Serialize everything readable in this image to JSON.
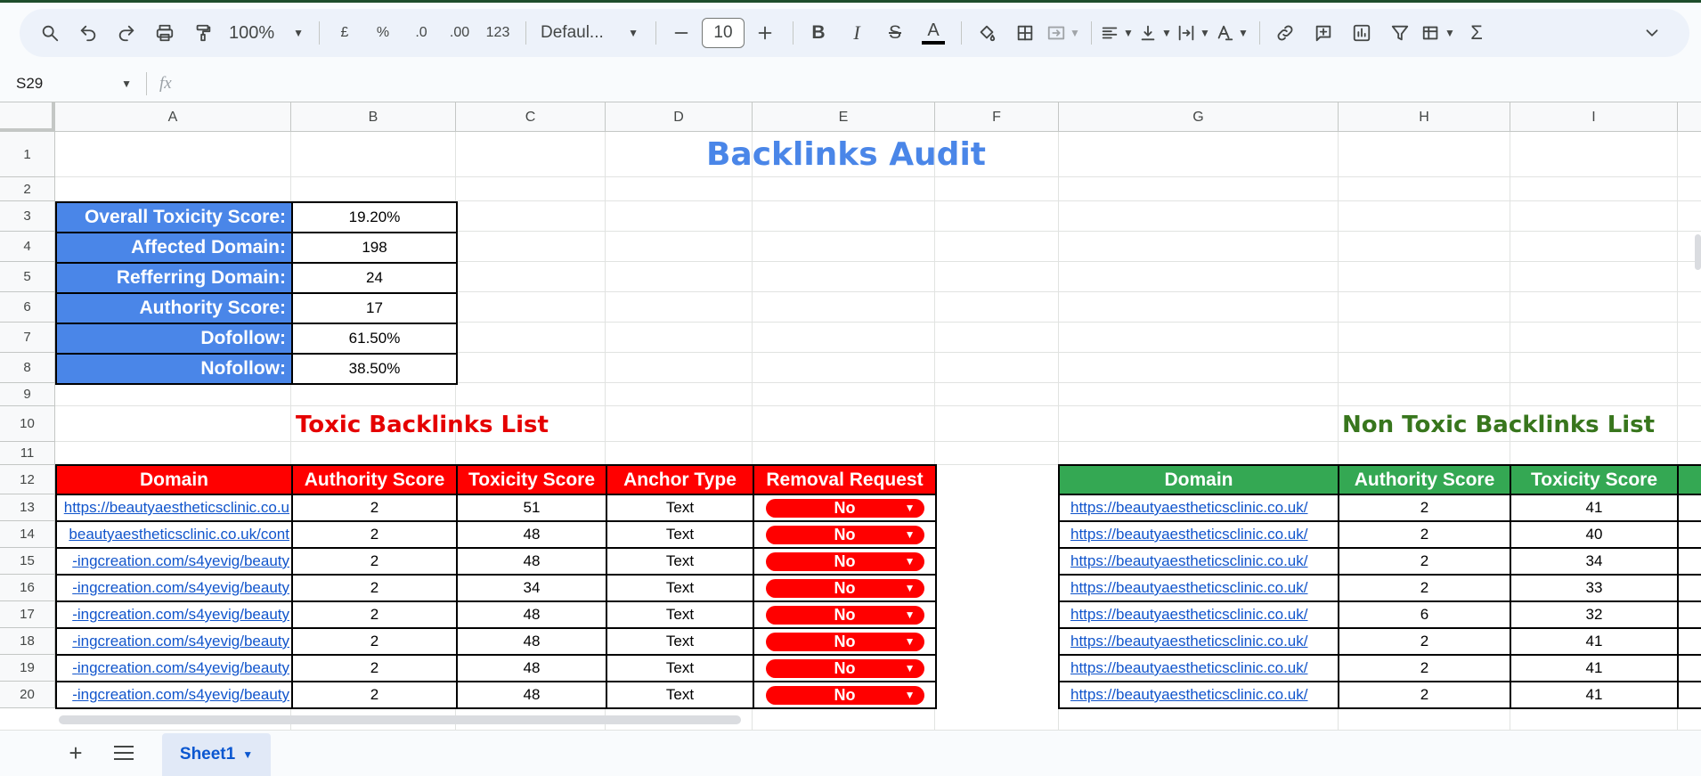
{
  "toolbar": {
    "zoom": "100%",
    "currency": "£",
    "percent": "%",
    "dec_decrease": ".0",
    "dec_increase": ".00",
    "number_format": "123",
    "font": "Defaul...",
    "font_size": "10",
    "bold": "B",
    "italic": "I",
    "strike": "S",
    "text_color": "A",
    "sum": "Σ"
  },
  "formula_bar": {
    "cell_ref": "S29",
    "fx": "fx",
    "value": ""
  },
  "columns": [
    "A",
    "B",
    "C",
    "D",
    "E",
    "F",
    "G",
    "H",
    "I"
  ],
  "rows": [
    "1",
    "2",
    "3",
    "4",
    "5",
    "6",
    "7",
    "8",
    "9",
    "10",
    "11",
    "12",
    "13",
    "14",
    "15",
    "16",
    "17",
    "18",
    "19",
    "20"
  ],
  "sheet": {
    "title": "Backlinks Audit",
    "summary": [
      {
        "label": "Overall Toxicity Score:",
        "value": "19.20%"
      },
      {
        "label": "Affected Domain:",
        "value": "198"
      },
      {
        "label": "Refferring Domain:",
        "value": "24"
      },
      {
        "label": "Authority Score:",
        "value": "17"
      },
      {
        "label": "Dofollow:",
        "value": "61.50%"
      },
      {
        "label": "Nofollow:",
        "value": "38.50%"
      }
    ],
    "toxic_title": "Toxic Backlinks List",
    "non_toxic_title": "Non Toxic Backlinks List",
    "toxic_headers": [
      "Domain",
      "Authority Score",
      "Toxicity Score",
      "Anchor Type",
      "Removal Request"
    ],
    "toxic_rows": [
      {
        "domain": "https://beautyaestheticsclinic.co.u",
        "authority": "2",
        "toxicity": "51",
        "anchor": "Text",
        "removal": "No"
      },
      {
        "domain": "beautyaestheticsclinic.co.uk/cont",
        "authority": "2",
        "toxicity": "48",
        "anchor": "Text",
        "removal": "No"
      },
      {
        "domain": "ingcreation.com/s4yevig/beauty-",
        "authority": "2",
        "toxicity": "48",
        "anchor": "Text",
        "removal": "No"
      },
      {
        "domain": "ingcreation.com/s4yevig/beauty-",
        "authority": "2",
        "toxicity": "34",
        "anchor": "Text",
        "removal": "No"
      },
      {
        "domain": "ingcreation.com/s4yevig/beauty-",
        "authority": "2",
        "toxicity": "48",
        "anchor": "Text",
        "removal": "No"
      },
      {
        "domain": "ingcreation.com/s4yevig/beauty-",
        "authority": "2",
        "toxicity": "48",
        "anchor": "Text",
        "removal": "No"
      },
      {
        "domain": "ingcreation.com/s4yevig/beauty-",
        "authority": "2",
        "toxicity": "48",
        "anchor": "Text",
        "removal": "No"
      },
      {
        "domain": "ingcreation.com/s4yevig/beauty-",
        "authority": "2",
        "toxicity": "48",
        "anchor": "Text",
        "removal": "No"
      }
    ],
    "non_toxic_headers": [
      "Domain",
      "Authority Score",
      "Toxicity Score"
    ],
    "non_toxic_rows": [
      {
        "domain": "https://beautyaestheticsclinic.co.uk/",
        "authority": "2",
        "toxicity": "41"
      },
      {
        "domain": "https://beautyaestheticsclinic.co.uk/",
        "authority": "2",
        "toxicity": "40"
      },
      {
        "domain": "https://beautyaestheticsclinic.co.uk/",
        "authority": "2",
        "toxicity": "34"
      },
      {
        "domain": "https://beautyaestheticsclinic.co.uk/",
        "authority": "2",
        "toxicity": "33"
      },
      {
        "domain": "https://beautyaestheticsclinic.co.uk/",
        "authority": "6",
        "toxicity": "32"
      },
      {
        "domain": "https://beautyaestheticsclinic.co.uk/",
        "authority": "2",
        "toxicity": "41"
      },
      {
        "domain": "https://beautyaestheticsclinic.co.uk/",
        "authority": "2",
        "toxicity": "41"
      },
      {
        "domain": "https://beautyaestheticsclinic.co.uk/",
        "authority": "2",
        "toxicity": "41"
      }
    ]
  },
  "tabs": [
    {
      "label": "Sheet1",
      "active": true
    }
  ],
  "colors": {
    "accent_blue": "#4a86e8",
    "toxic_red": "#ff0000",
    "safe_green": "#34a853",
    "title_green": "#38761d",
    "link": "#1155cc"
  }
}
